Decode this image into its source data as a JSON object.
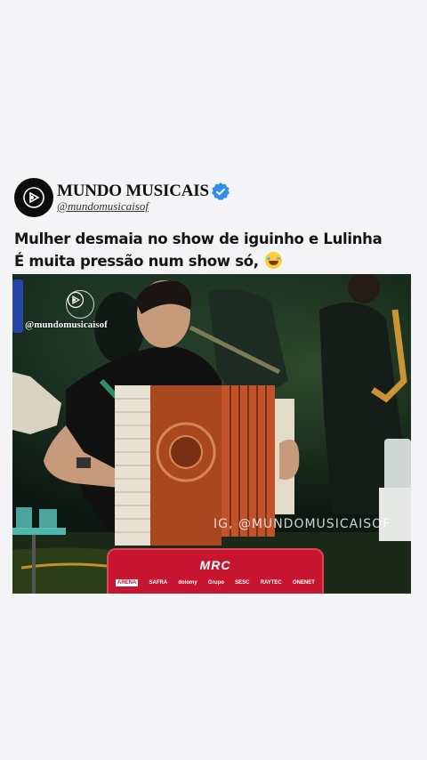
{
  "post": {
    "display_name": "MUNDO MUSICAIS",
    "handle": "@mundomusicaisof",
    "verified": true,
    "caption_line1": "Mulher desmaia no show de iguinho e Lulinha",
    "caption_line2": "É muita pressão num show só,"
  },
  "video": {
    "overlay_handle": "@mundomusicaisof",
    "watermark": "IG, @MUNDOMUSICAISOF",
    "banner_logo": "MRC",
    "sponsors": [
      "ARENA",
      "SAFRA",
      "dolomy",
      "Grupo",
      "SESC",
      "RAYTEC",
      "ONENET"
    ]
  },
  "colors": {
    "avatar_bg": "#0c0c0c",
    "verified": "#2f8fe8",
    "banner": "#c8152f",
    "accordion": "#a9471f"
  }
}
